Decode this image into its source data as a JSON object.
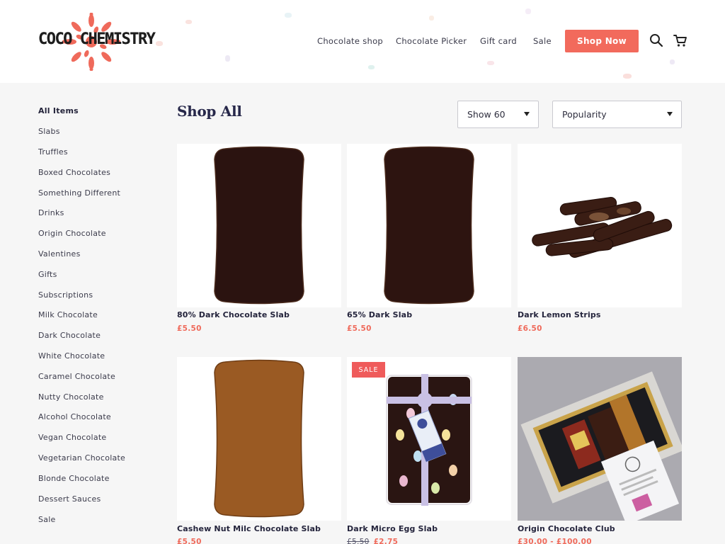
{
  "brand": {
    "name": "COCO CHEMISTRY",
    "accent": "#f26a5c",
    "logo_flower_color": "#ef6a5b"
  },
  "nav": {
    "items": [
      "Chocolate shop",
      "Chocolate Picker",
      "Gift card",
      "Sale"
    ],
    "cta": "Shop Now",
    "icons": [
      "search-icon",
      "cart-icon"
    ]
  },
  "sidebar": {
    "items": [
      "All Items",
      "Slabs",
      "Truffles",
      "Boxed Chocolates",
      "Something Different",
      "Drinks",
      "Origin Chocolate",
      "Valentines",
      "Gifts",
      "Subscriptions",
      "Milk Chocolate",
      "Dark Chocolate",
      "White Chocolate",
      "Caramel Chocolate",
      "Nutty Chocolate",
      "Alcohol Chocolate",
      "Vegan Chocolate",
      "Vegetarian Chocolate",
      "Blonde Chocolate",
      "Dessert Sauces",
      "Sale"
    ],
    "active": "All Items"
  },
  "main": {
    "title": "Shop All",
    "per_page": "Show 60",
    "sort": "Popularity"
  },
  "products": [
    {
      "name": "80% Dark Chocolate Slab",
      "price": "£5.50",
      "image": "dark-slab"
    },
    {
      "name": "65% Dark Slab",
      "price": "£5.50",
      "image": "dark-slab"
    },
    {
      "name": "Dark Lemon Strips",
      "price": "£6.50",
      "image": "strips"
    },
    {
      "name": "Cashew Nut Milc Chocolate Slab",
      "price": "£5.50",
      "image": "milk-slab"
    },
    {
      "name": "Dark Micro Egg Slab",
      "old_price": "£5.50",
      "price": "£2.75",
      "badge": "SALE",
      "image": "egg-slab"
    },
    {
      "name": "Origin Chocolate Club",
      "price": "£30.00 - £100.00",
      "image": "gift-box"
    }
  ]
}
